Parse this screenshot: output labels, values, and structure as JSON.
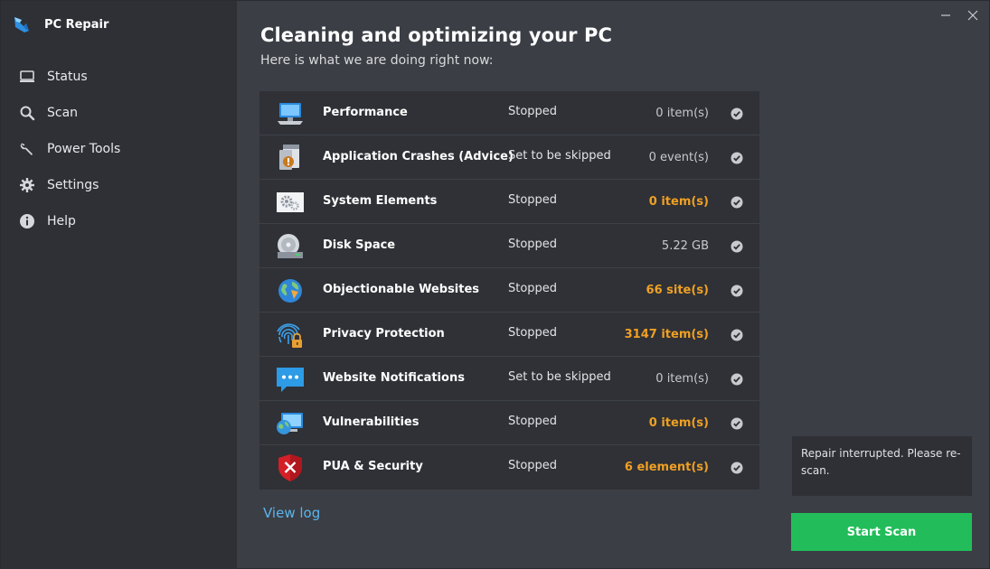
{
  "app": {
    "title": "PC Repair"
  },
  "colors": {
    "sidebar_bg": "#2e3035",
    "main_bg": "#3b3e45",
    "table_bg": "#2f3136",
    "warning_orange": "#f0a024",
    "link_blue": "#5cb4ec",
    "start_green": "#22bd5a"
  },
  "nav": {
    "items": [
      {
        "label": "Status",
        "icon": "monitor-icon"
      },
      {
        "label": "Scan",
        "icon": "search-icon"
      },
      {
        "label": "Power Tools",
        "icon": "wrench-icon"
      },
      {
        "label": "Settings",
        "icon": "gear-icon"
      },
      {
        "label": "Help",
        "icon": "info-icon"
      }
    ]
  },
  "main": {
    "title": "Cleaning and optimizing your PC",
    "subtitle": "Here is what we are doing right now:"
  },
  "scan_rows": [
    {
      "name": "Performance",
      "status": "Stopped",
      "count": "0 item(s)",
      "highlight": false,
      "icon": "computer-icon"
    },
    {
      "name": "Application Crashes (Advice)",
      "status": "Set to be skipped",
      "count": "0 event(s)",
      "highlight": false,
      "icon": "app-crash-icon"
    },
    {
      "name": "System Elements",
      "status": "Stopped",
      "count": "0 item(s)",
      "highlight": true,
      "icon": "gears-icon"
    },
    {
      "name": "Disk Space",
      "status": "Stopped",
      "count": "5.22 GB",
      "highlight": false,
      "icon": "disk-icon"
    },
    {
      "name": "Objectionable Websites",
      "status": "Stopped",
      "count": "66 site(s)",
      "highlight": true,
      "icon": "globe-icon"
    },
    {
      "name": "Privacy Protection",
      "status": "Stopped",
      "count": "3147 item(s)",
      "highlight": true,
      "icon": "fingerprint-lock-icon"
    },
    {
      "name": "Website Notifications",
      "status": "Set to be skipped",
      "count": "0 item(s)",
      "highlight": false,
      "icon": "chat-bubble-icon"
    },
    {
      "name": "Vulnerabilities",
      "status": "Stopped",
      "count": "0 item(s)",
      "highlight": true,
      "icon": "globe-monitor-icon"
    },
    {
      "name": "PUA & Security",
      "status": "Stopped",
      "count": "6 element(s)",
      "highlight": true,
      "icon": "shield-x-icon"
    }
  ],
  "footer": {
    "view_log": "View log",
    "message": "Repair interrupted. Please re-scan.",
    "start_scan": "Start Scan"
  }
}
